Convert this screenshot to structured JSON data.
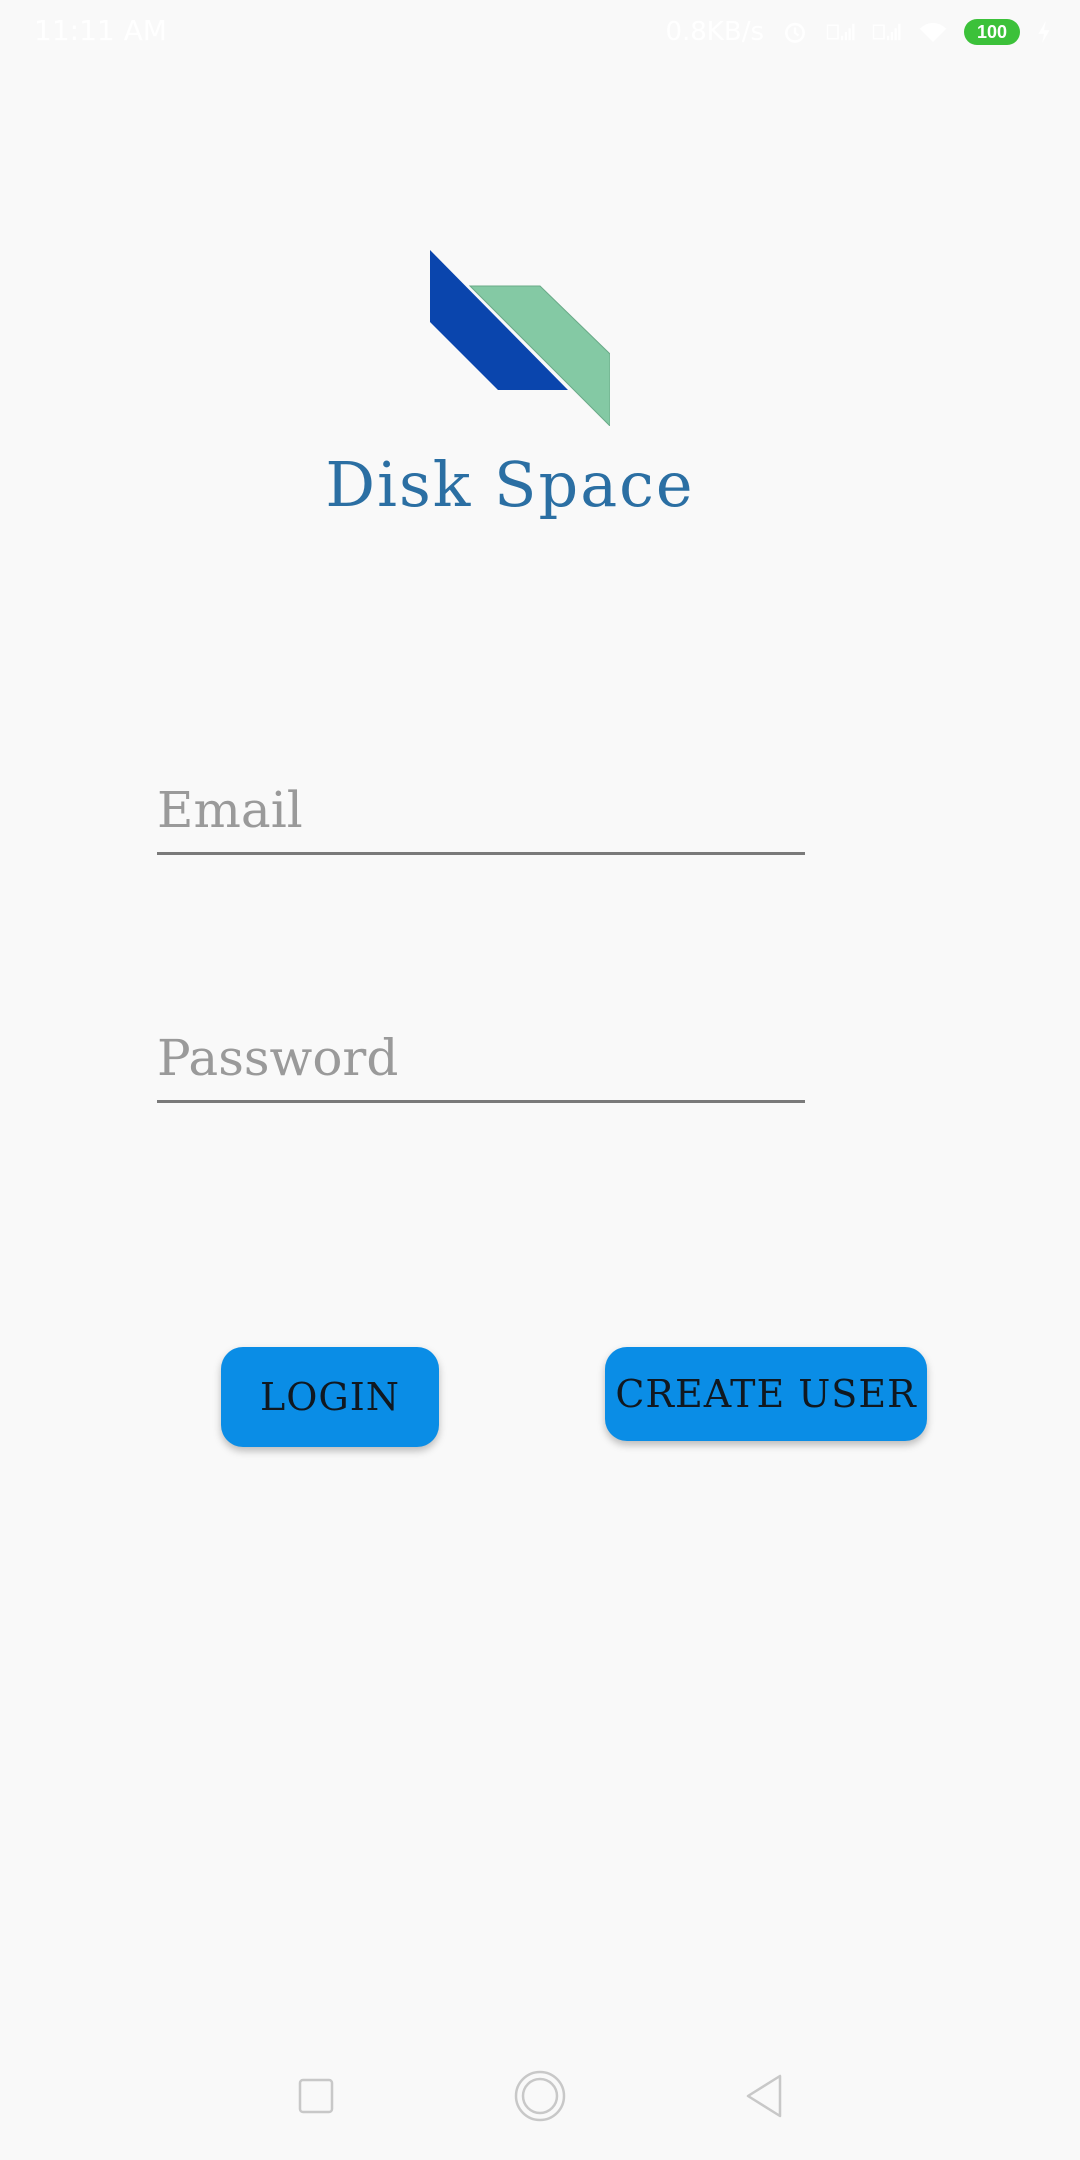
{
  "status_bar": {
    "time": "11:11 AM",
    "network_speed": "0.8KB/s",
    "battery_level": "100",
    "icons": [
      "alarm-icon",
      "sim1-signal-icon",
      "sim2-signal-icon",
      "wifi-icon",
      "battery-icon",
      "charging-icon"
    ]
  },
  "app": {
    "title": "Disk Space",
    "logo_colors": {
      "dark": "#0a45ad",
      "light": "#84c9a4"
    }
  },
  "login_form": {
    "email_placeholder": "Email",
    "email_value": "",
    "password_placeholder": "Password",
    "password_value": ""
  },
  "buttons": {
    "login_label": "LOGIN",
    "create_user_label": "CREATE USER"
  },
  "nav_bar": {
    "items": [
      "recents-icon",
      "home-icon",
      "back-icon"
    ]
  },
  "colors": {
    "accent": "#0a8de6",
    "title": "#2b6fa3",
    "background": "#f9f9f9"
  }
}
